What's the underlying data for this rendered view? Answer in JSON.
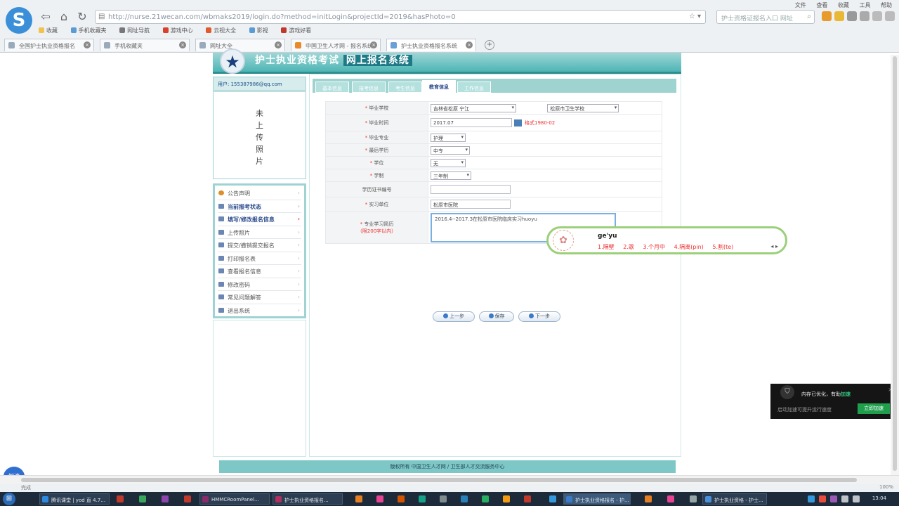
{
  "browser": {
    "logo": "S",
    "address": "http://nurse.21wecan.com/wbmaks2019/login.do?method=initLogin&projectId=2019&hasPhoto=0",
    "search_placeholder": "护士资格证报名入口 网址",
    "window_menu": [
      "文件",
      "查看",
      "收藏",
      "工具",
      "帮助"
    ],
    "bookmarks": [
      "收藏",
      "手机收藏夹",
      "网址导航",
      "游戏中心",
      "云视大全",
      "影视",
      "游戏好看"
    ],
    "tabs": [
      {
        "title": "全国护士执业资格报名",
        "active": false
      },
      {
        "title": "手机收藏夹",
        "active": false
      },
      {
        "title": "网址大全",
        "active": false
      },
      {
        "title": "中国卫生人才网 - 报名系统",
        "active": false
      },
      {
        "title": "护士执业资格报名系统",
        "active": true
      }
    ]
  },
  "site": {
    "title": "护士执业资格考试",
    "title_tag": "网上报名系统",
    "user_email": "用户: 155387986@qq.com",
    "photo_placeholder": [
      "未",
      "上",
      "传",
      "照",
      "片"
    ],
    "menu": [
      {
        "label": "公告声明",
        "bold": false
      },
      {
        "label": "当前报考状态",
        "bold": true
      },
      {
        "label": "填写/修改报名信息",
        "bold": true
      },
      {
        "label": "上传照片",
        "bold": false
      },
      {
        "label": "提交/撤销提交报名",
        "bold": false
      },
      {
        "label": "打印报名表",
        "bold": false
      },
      {
        "label": "查看报名信息",
        "bold": false
      },
      {
        "label": "修改密码",
        "bold": false
      },
      {
        "label": "常见问题解答",
        "bold": false
      },
      {
        "label": "退出系统",
        "bold": false
      }
    ],
    "steps": [
      "基本信息",
      "报考信息",
      "考生信息",
      "教育信息",
      "工作信息"
    ],
    "form": {
      "school_label": "毕业学校",
      "school_region": "吉林省松原 宁江",
      "school_name": "松原市卫生学校",
      "grad_date_label": "毕业时间",
      "grad_date": "2017.07",
      "grad_date_hint": "格式1980-02",
      "major_label": "毕业专业",
      "major": "护理",
      "edu_label": "最后学历",
      "edu": "中专",
      "degree_label": "学位",
      "degree": "无",
      "years_label": "学制",
      "years": "三年制",
      "cert_label": "学历证书编号",
      "cert": "",
      "intern_label": "实习单位",
      "intern": "松原市医院",
      "resume_label": "专业学习简历",
      "resume_note": "（限200字以内）",
      "resume": "2016.4--2017.3在松原市医院临床实习huoyu"
    },
    "buttons": [
      "上一步",
      "保存",
      "下一步"
    ],
    "footer": "版权所有 中国卫生人才网 / 卫生部人才交流服务中心"
  },
  "ime": {
    "composition": "ge'yu",
    "candidates": [
      "1.隔壁",
      "2.歌",
      "3.个月中",
      "4.隔离(pin)",
      "5.割(te)"
    ]
  },
  "notification": {
    "line1": "内存已优化，有助",
    "line1_em": "加速",
    "line2": "启动加速可提升运行速度",
    "button": "立即加速"
  },
  "sidebadge": "加速",
  "statusbar": {
    "left": "完成",
    "right": "100%"
  },
  "taskbar": {
    "tasks": [
      {
        "label": "腾讯课堂 | yod 直 4.7...",
        "color": "#2c8ae0"
      },
      {
        "label": "HMMCRoomPanel...",
        "color": "#8a2b6a"
      },
      {
        "label": "护士执业资格报名...",
        "color": "#b03060"
      },
      {
        "label": "护士执业资格报名 - 护...",
        "color": "#3a7ac6"
      },
      {
        "label": "护士执业资格 - 护士...",
        "color": "#4a90d9"
      }
    ],
    "clock": "13:04"
  }
}
